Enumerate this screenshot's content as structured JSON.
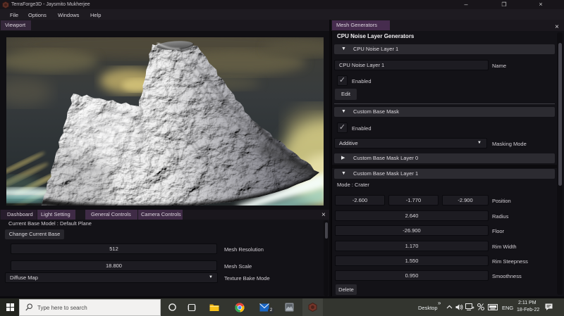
{
  "window": {
    "title": "TerraForge3D - Jaysmito Mukherjee"
  },
  "icons": {
    "minimize": "–",
    "maximize": "❐",
    "close": "×",
    "panel_close": "×",
    "header_open": "▼",
    "header_closed": "▶",
    "combo_arrow": "▼",
    "checkbox_check": "✓",
    "tray_chevron_more": "»",
    "tray_chevron_up": "⌃"
  },
  "menu": {
    "items": [
      "File",
      "Options",
      "Windows",
      "Help"
    ]
  },
  "viewport_panel": {
    "tab": "Viewport"
  },
  "mesh_panel": {
    "tab": "Mesh Generators",
    "heading": "CPU Noise Layer Generators",
    "noise_layer": {
      "header": "CPU Noise Layer 1",
      "name_value": "CPU Noise Layer 1",
      "name_label": "Name",
      "enabled_label": "Enabled",
      "edit_label": "Edit"
    },
    "base_mask": {
      "header": "Custom Base Mask",
      "enabled_label": "Enabled",
      "masking_mode_value": "Additive",
      "masking_mode_label": "Masking Mode",
      "layer0_header": "Custom Base Mask Layer 0",
      "layer1_header": "Custom Base Mask Layer 1",
      "mode_text": "Mode : Crater",
      "position": {
        "label": "Position",
        "values": [
          "-2.600",
          "-1.770",
          "-2.900"
        ]
      },
      "params": [
        {
          "label": "Radius",
          "value": "2.640"
        },
        {
          "label": "Floor",
          "value": "-26.900"
        },
        {
          "label": "Rim Width",
          "value": "1.170"
        },
        {
          "label": "Rim Steepness",
          "value": "1.550"
        },
        {
          "label": "Smoothness",
          "value": "0.950"
        }
      ],
      "delete_label": "Delete"
    }
  },
  "dashboard_panel": {
    "tabs": [
      "Dashboard",
      "Light Setting",
      "General Controls",
      "Camera Controls"
    ],
    "current_base_text": "Current Base Model : Default Plane",
    "change_base_button": "Change Current Base",
    "fields": [
      {
        "label": "Mesh Resolution",
        "value": "512"
      },
      {
        "label": "Mesh Scale",
        "value": "18.800"
      }
    ],
    "bake_mode": {
      "value": "Diffuse Map",
      "label": "Texture Bake Mode"
    }
  },
  "taskbar": {
    "search_placeholder": "Type here to search",
    "mail_badge": "2",
    "tray": {
      "desktop_label": "Desktop",
      "language": "ENG",
      "time": "2:11 PM",
      "date": "18-Feb-22"
    }
  },
  "colors": {
    "accent_tab": "#462c4e",
    "tab_dim": "#271c2c",
    "panel_bg": "#131217",
    "header_bg": "#2c2b31",
    "taskbar_bg": "#33352f"
  }
}
